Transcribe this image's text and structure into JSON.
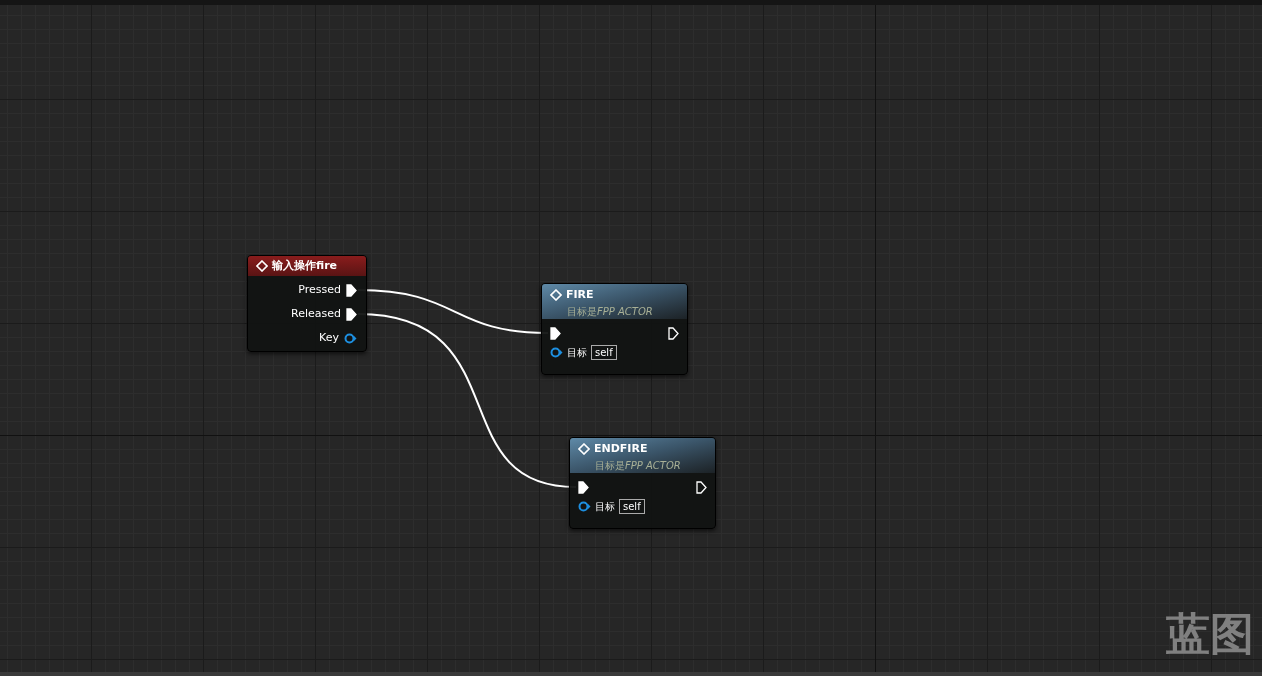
{
  "graph_label": "蓝图",
  "event_node": {
    "title": "输入操作fire",
    "pins": [
      {
        "label": "Pressed",
        "kind": "exec"
      },
      {
        "label": "Released",
        "kind": "exec"
      },
      {
        "label": "Key",
        "kind": "data"
      }
    ]
  },
  "function_nodes": [
    {
      "title": "FIRE",
      "subtitle_prefix": "目标是",
      "subtitle_class": "FPP ACTOR",
      "target_label": "目标",
      "target_value": "self"
    },
    {
      "title": "ENDFIRE",
      "subtitle_prefix": "目标是",
      "subtitle_class": "FPP ACTOR",
      "target_label": "目标",
      "target_value": "self"
    }
  ]
}
